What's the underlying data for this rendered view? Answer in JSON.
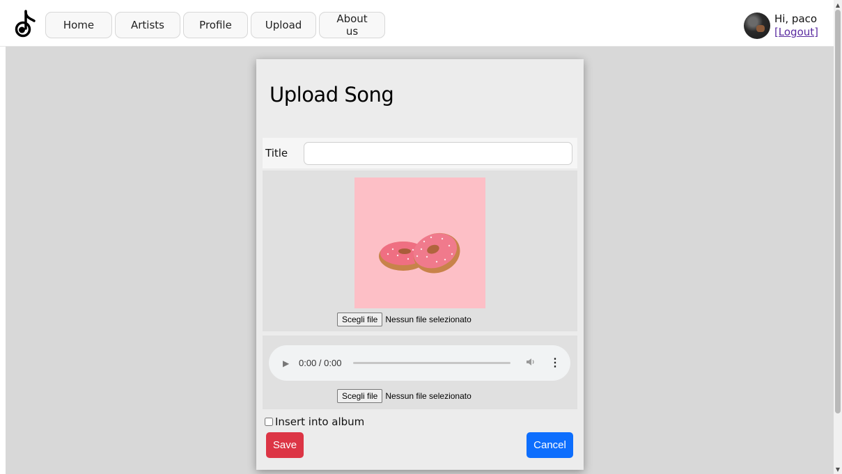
{
  "nav": {
    "items": [
      {
        "label": "Home"
      },
      {
        "label": "Artists"
      },
      {
        "label": "Profile"
      },
      {
        "label": "Upload"
      },
      {
        "label": "About us"
      }
    ]
  },
  "user": {
    "greeting": "Hi, paco",
    "logout": "[Logout]"
  },
  "form": {
    "heading": "Upload Song",
    "title_label": "Title",
    "title_value": "",
    "image_file": {
      "button": "Scegli file",
      "status": "Nessun file selezionato"
    },
    "audio": {
      "time": "0:00 / 0:00"
    },
    "audio_file": {
      "button": "Scegli file",
      "status": "Nessun file selezionato"
    },
    "album_checkbox_label": "Insert into album",
    "album_checked": false,
    "save_label": "Save",
    "cancel_label": "Cancel"
  },
  "colors": {
    "save": "#dc3545",
    "cancel": "#0d6efd",
    "cover_bg": "#fdbfc6",
    "page_bg": "#d8d8d8"
  },
  "icons": {
    "logo": "music-note-icon",
    "avatar": "user-avatar",
    "play": "play-icon",
    "volume": "volume-icon",
    "more": "more-options-icon"
  }
}
